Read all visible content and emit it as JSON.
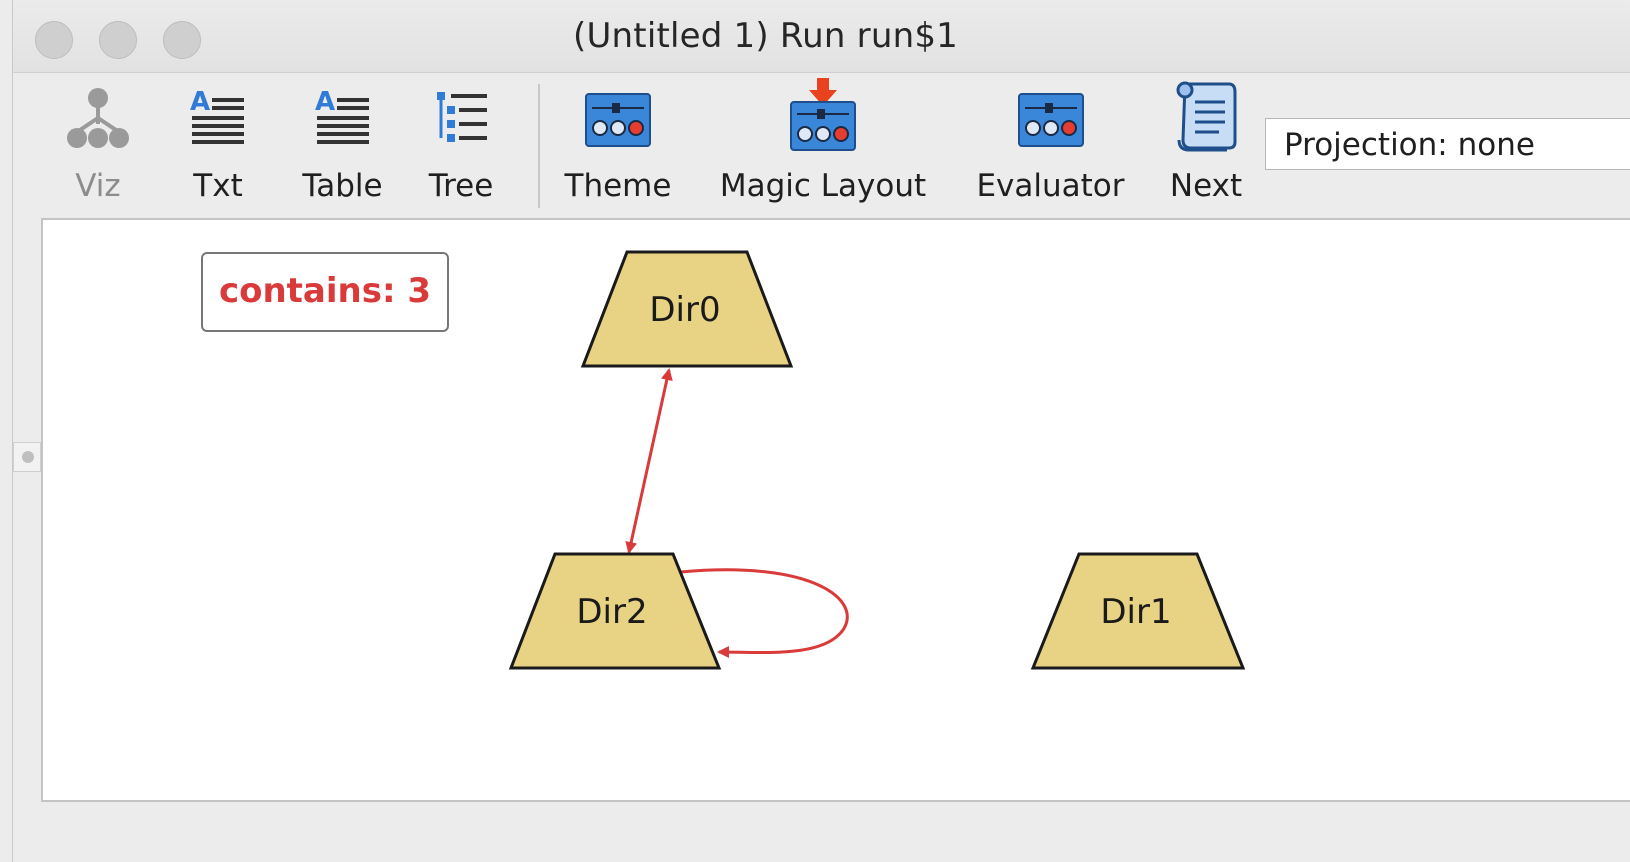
{
  "window": {
    "title": "(Untitled 1) Run run$1"
  },
  "toolbar": {
    "viz_label": "Viz",
    "txt_label": "Txt",
    "table_label": "Table",
    "tree_label": "Tree",
    "theme_label": "Theme",
    "magic_layout_label": "Magic Layout",
    "evaluator_label": "Evaluator",
    "next_label": "Next",
    "projection_value": "Projection: none"
  },
  "graph": {
    "legend": "contains: 3",
    "accent_color": "#d93a3a",
    "node_color": "#e8d284",
    "nodes": [
      {
        "label": "Dir0"
      },
      {
        "label": "Dir2"
      },
      {
        "label": "Dir1"
      }
    ]
  }
}
